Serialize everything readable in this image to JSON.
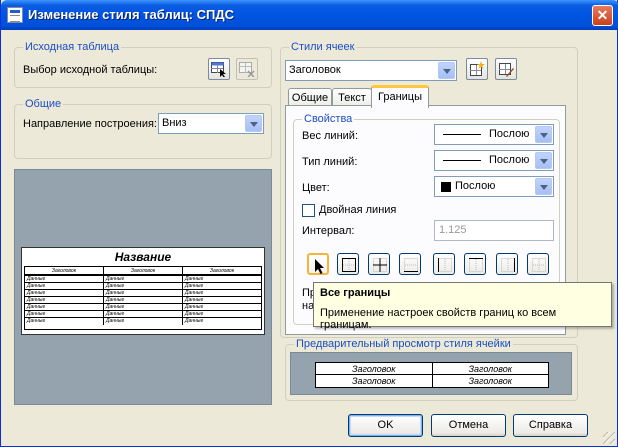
{
  "window": {
    "title": "Изменение стиля таблиц: СПДС",
    "close_glyph": "✕"
  },
  "source_table": {
    "legend": "Исходная таблица",
    "select_label": "Выбор исходной таблицы:"
  },
  "general": {
    "legend": "Общие",
    "direction_label": "Направление построения:",
    "direction_value": "Вниз"
  },
  "preview_table": {
    "title": "Название",
    "header": [
      "Заголовок",
      "Заголовок",
      "Заголовок"
    ],
    "rows": [
      [
        "Данные",
        "Данные",
        "Данные"
      ],
      [
        "Данные",
        "Данные",
        "Данные"
      ],
      [
        "Данные",
        "Данные",
        "Данные"
      ],
      [
        "Данные",
        "Данные",
        "Данные"
      ],
      [
        "Данные",
        "Данные",
        "Данные"
      ],
      [
        "Данные",
        "Данные",
        "Данные"
      ],
      [
        "Данные",
        "Данные",
        "Данные"
      ]
    ]
  },
  "cell_styles": {
    "legend": "Стили ячеек",
    "selected": "Заголовок",
    "tabs": [
      "Общие",
      "Текст",
      "Границы"
    ],
    "active_tab": "Границы"
  },
  "properties": {
    "legend": "Свойства",
    "line_weight_label": "Вес линий:",
    "line_weight_value": "Послою",
    "line_type_label": "Тип линий:",
    "line_type_value": "Послою",
    "color_label": "Цвет:",
    "color_value": "Послою",
    "double_line_label": "Двойная линия",
    "double_line_checked": false,
    "interval_label": "Интервал:",
    "interval_value": "1.125",
    "partial_label_1": "Пр",
    "partial_label_2": "на"
  },
  "border_buttons": [
    "all-borders",
    "outer-borders",
    "inner-borders",
    "bottom-border",
    "left-border",
    "top-border",
    "right-border",
    "no-borders"
  ],
  "tooltip": {
    "title": "Все границы",
    "body": "Применение настроек свойств границ ко всем границам."
  },
  "cell_preview": {
    "legend": "Предварительный просмотр стиля ячейки",
    "cells": [
      [
        "Заголовок",
        "Заголовок"
      ],
      [
        "Заголовок",
        "Заголовок"
      ]
    ]
  },
  "buttons": {
    "ok": "OK",
    "cancel": "Отмена",
    "help": "Справка"
  },
  "colors": {
    "title_bar": "#0054e3",
    "legend_text": "#1a4fc4",
    "dialog_bg": "#ece9d8",
    "preview_bg": "#95a3ae",
    "tooltip_bg": "#ffffe1"
  }
}
